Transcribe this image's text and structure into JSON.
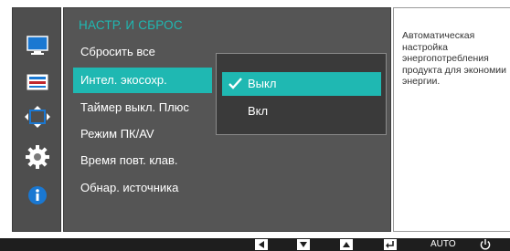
{
  "menu": {
    "title": "НАСТР. И СБРОС",
    "items": [
      "Сбросить все",
      "Интел. экосохр.",
      "Таймер выкл. Плюс",
      "Режим ПК/AV",
      "Время повт. клав.",
      "Обнар. источника"
    ],
    "selected_index": 1
  },
  "submenu": {
    "options": [
      "Выкл",
      "Вкл"
    ],
    "selected_index": 0
  },
  "info": {
    "text": "Автоматическая настройка энергопотребления продукта для экономии энергии."
  },
  "sidebar": {
    "icons": [
      "picture-icon",
      "onscreen-display-icon",
      "position-icon",
      "settings-icon",
      "information-icon"
    ],
    "active_index": 3
  },
  "bottombar": {
    "auto_label": "AUTO",
    "buttons": [
      "left-arrow-button",
      "down-arrow-button",
      "up-arrow-button",
      "enter-button",
      "auto-button",
      "power-button"
    ]
  },
  "colors": {
    "accent": "#1fb8b2",
    "menu_bg": "#555555",
    "sidebar_bg": "#4e4e4e",
    "submenu_bg": "#3a3a3a",
    "bottom_bg": "#1e1e1e",
    "icon_blue": "#1a78d2"
  }
}
